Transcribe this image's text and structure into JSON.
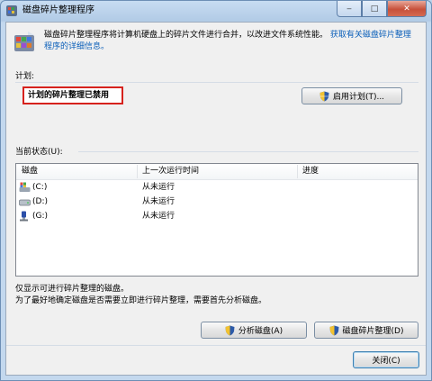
{
  "window": {
    "title": "磁盘碎片整理程序"
  },
  "caption_buttons": {
    "minimize": "‒",
    "maximize": "□",
    "close": "✕"
  },
  "intro": {
    "text": "磁盘碎片整理程序将计算机硬盘上的碎片文件进行合并，以改进文件系统性能。",
    "link": "获取有关磁盘碎片整理程序的详细信息。"
  },
  "schedule": {
    "label": "计划:",
    "status": "计划的碎片整理已禁用",
    "enable_button": "启用计划(T)..."
  },
  "current_status": {
    "label": "当前状态(U):",
    "columns": [
      "磁盘",
      "上一次运行时间",
      "进度"
    ],
    "rows": [
      {
        "disk": "(C:)",
        "last_run": "从未运行",
        "progress": "",
        "icon": "system-drive-icon"
      },
      {
        "disk": "(D:)",
        "last_run": "从未运行",
        "progress": "",
        "icon": "hard-drive-icon"
      },
      {
        "disk": "(G:)",
        "last_run": "从未运行",
        "progress": "",
        "icon": "usb-drive-icon"
      }
    ]
  },
  "notes": {
    "line1": "仅显示可进行碎片整理的磁盘。",
    "line2": "为了最好地确定磁盘是否需要立即进行碎片整理，需要首先分析磁盘。"
  },
  "actions": {
    "analyze": "分析磁盘(A)",
    "defragment": "磁盘碎片整理(D)",
    "close": "关闭(C)"
  },
  "colors": {
    "title_bar": "#c4d9ef",
    "status_outline": "#d6221d",
    "link": "#0b5fb9"
  }
}
